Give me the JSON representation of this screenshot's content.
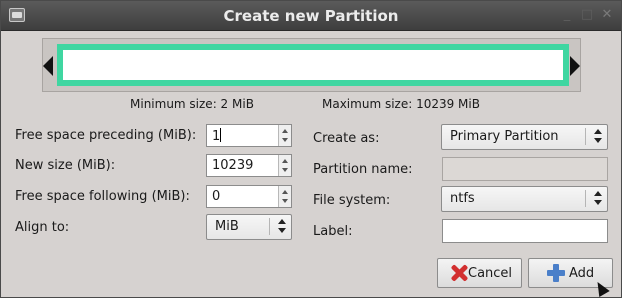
{
  "window": {
    "title": "Create new Partition",
    "controls": {
      "minimize": "_",
      "maximize": "□",
      "close": "✕"
    }
  },
  "graph": {
    "partition_color": "#3fd6a1"
  },
  "sizes": {
    "minimum": "Minimum size: 2 MiB",
    "maximum": "Maximum size: 10239 MiB"
  },
  "left": {
    "free_preceding_label": "Free space preceding (MiB):",
    "free_preceding_value": "1",
    "new_size_label": "New size (MiB):",
    "new_size_value": "10239",
    "free_following_label": "Free space following (MiB):",
    "free_following_value": "0",
    "align_label": "Align to:",
    "align_value": "MiB"
  },
  "right": {
    "create_as_label": "Create as:",
    "create_as_value": "Primary Partition",
    "partition_name_label": "Partition name:",
    "partition_name_value": "",
    "file_system_label": "File system:",
    "file_system_value": "ntfs",
    "label_label": "Label:",
    "label_value": ""
  },
  "buttons": {
    "cancel": "Cancel",
    "add": "Add"
  },
  "icons": {
    "app": "gparted-icon",
    "cancel": "cancel-x-icon",
    "add": "add-plus-icon"
  }
}
